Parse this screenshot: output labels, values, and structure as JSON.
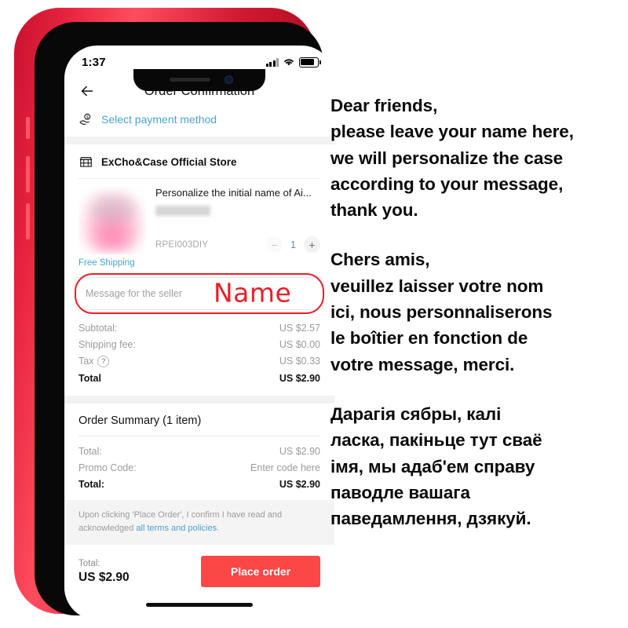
{
  "phone": {
    "status_bar": {
      "time": "1:37",
      "signal_icon": "signal-bars-icon",
      "wifi_icon": "wifi-icon",
      "battery_icon": "battery-icon"
    },
    "header": {
      "back_icon": "back-arrow-icon",
      "title": "Order Confirmation",
      "payment_icon": "hand-coin-icon",
      "payment_label": "Select payment method"
    },
    "store": {
      "icon": "storefront-icon",
      "name": "ExCho&Case Official Store"
    },
    "product": {
      "title": "Personalize the initial name of Ai...",
      "sku": "RPEI003DIY",
      "quantity": "1",
      "decrease_label": "−",
      "increase_label": "+",
      "free_shipping": "Free Shipping"
    },
    "message_field": {
      "placeholder": "Message for the seller",
      "annotation_text": "Name",
      "annotation_color": "#e8202a"
    },
    "price_rows": [
      {
        "label": "Subtotal:",
        "value": "US $2.57",
        "bold": false,
        "help": false
      },
      {
        "label": "Shipping fee:",
        "value": "US $0.00",
        "bold": false,
        "help": false
      },
      {
        "label": "Tax",
        "value": "US $0.33",
        "bold": false,
        "help": true
      },
      {
        "label": "Total",
        "value": "US $2.90",
        "bold": true,
        "help": false
      }
    ],
    "order_summary": {
      "title": "Order Summary (1 item)",
      "rows": [
        {
          "label": "Total:",
          "value": "US $2.90",
          "link": false,
          "bold": false
        },
        {
          "label": "Promo Code:",
          "value": "Enter code here",
          "link": true,
          "bold": false
        },
        {
          "label": "Total:",
          "value": "US $2.90",
          "link": false,
          "bold": true
        }
      ]
    },
    "terms": {
      "text_before": "Upon clicking 'Place Order', I confirm I have read and acknowledged ",
      "link_text": "all terms and policies",
      "text_after": "."
    },
    "checkout": {
      "total_label": "Total:",
      "total_amount": "US $2.90",
      "place_order_label": "Place order",
      "button_color": "#fc4747"
    }
  },
  "panel": {
    "paragraphs": [
      {
        "language": "english",
        "lines": [
          "Dear friends,",
          "please leave your name here,",
          "we will personalize the case",
          "according to your message,",
          "thank you."
        ]
      },
      {
        "language": "french",
        "lines": [
          "Chers amis,",
          "veuillez laisser votre nom",
          "ici, nous personnaliserons",
          "le boîtier en fonction de",
          "votre message, merci."
        ]
      },
      {
        "language": "belarusian",
        "lines": [
          "Дарагія сябры, калі",
          "ласка, пакіньце тут сваё",
          "імя, мы адаб'ем справу",
          "паводле вашага",
          "паведамлення, дзякуй."
        ]
      }
    ]
  }
}
